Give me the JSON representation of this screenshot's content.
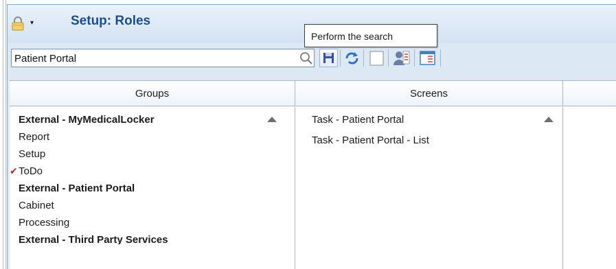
{
  "window": {
    "title": "Setup: Roles",
    "menu_caret": "▾"
  },
  "search": {
    "value": "Patient Portal",
    "placeholder": ""
  },
  "tooltip": {
    "text": "Perform the search"
  },
  "grid": {
    "columns": [
      "Groups",
      "Screens",
      ""
    ],
    "groups": [
      {
        "label": "External - MyMedicalLocker",
        "bold": true,
        "checked": false
      },
      {
        "label": "Report",
        "bold": false,
        "checked": false
      },
      {
        "label": "Setup",
        "bold": false,
        "checked": false
      },
      {
        "label": "ToDo",
        "bold": false,
        "checked": true
      },
      {
        "label": "External - Patient Portal",
        "bold": true,
        "checked": false
      },
      {
        "label": "Cabinet",
        "bold": false,
        "checked": false
      },
      {
        "label": "Processing",
        "bold": false,
        "checked": false
      },
      {
        "label": "External - Third Party Services",
        "bold": true,
        "checked": false
      }
    ],
    "screens": [
      {
        "label": "Task - Patient Portal"
      },
      {
        "label": "Task - Patient Portal - List"
      }
    ]
  },
  "icons": {
    "check_glyph": "✔",
    "accent": "#1b4f89",
    "check_color": "#c0282c"
  }
}
